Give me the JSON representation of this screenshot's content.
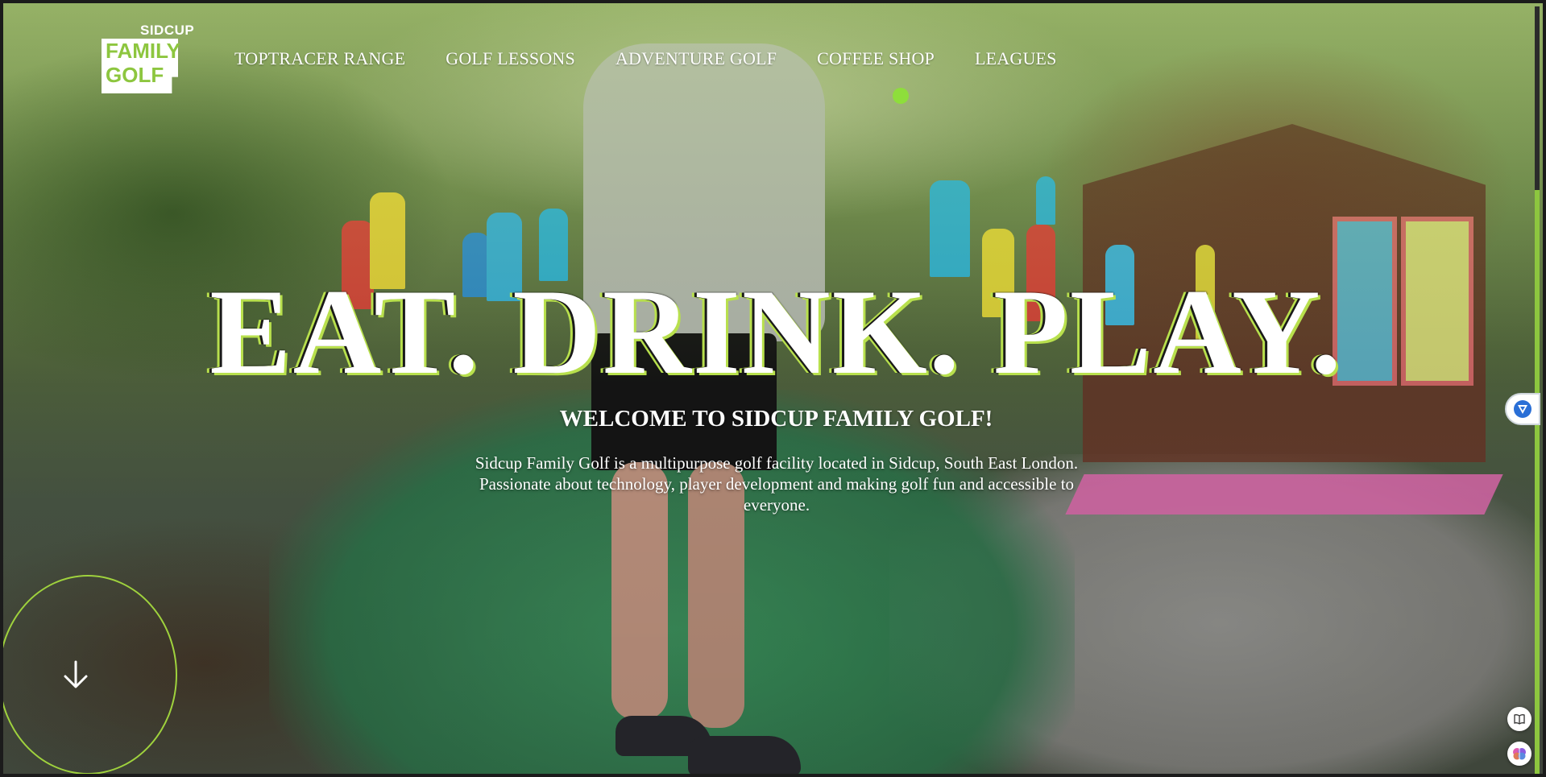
{
  "brand": {
    "sidcup": "SIDCUP",
    "family": "FAMILY",
    "golf": "GOLF"
  },
  "nav": {
    "items": [
      {
        "label": "TOPTRACER RANGE"
      },
      {
        "label": "GOLF LESSONS"
      },
      {
        "label": "ADVENTURE GOLF"
      },
      {
        "label": "COFFEE SHOP"
      },
      {
        "label": "LEAGUES"
      }
    ]
  },
  "hero": {
    "headline": "EAT. DRINK. PLAY.",
    "welcome": "WELCOME TO SIDCUP FAMILY GOLF!",
    "intro": "Sidcup Family Golf is a multipurpose golf facility located in Sidcup, South East London. Passionate about technology, player development and making golf fun and accessible to everyone."
  },
  "icons": {
    "scroll": "arrow-down-icon",
    "extension": "v-shield-icon",
    "reader": "book-icon",
    "assistant": "brain-icon"
  },
  "colors": {
    "accent": "#8dc63f",
    "accent_bright": "#8ede3b",
    "text": "#ffffff"
  }
}
